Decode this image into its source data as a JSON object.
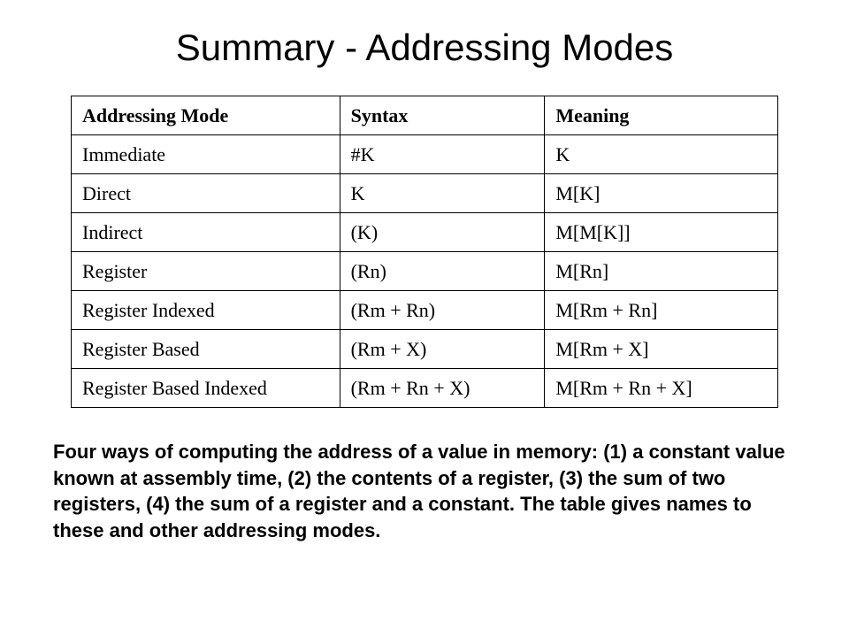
{
  "title": "Summary - Addressing Modes",
  "headers": {
    "col0": "Addressing Mode",
    "col1": "Syntax",
    "col2": "Meaning"
  },
  "rows": [
    {
      "mode": "Immediate",
      "syntax": "#K",
      "meaning": "K"
    },
    {
      "mode": "Direct",
      "syntax": "K",
      "meaning": "M[K]"
    },
    {
      "mode": "Indirect",
      "syntax": "(K)",
      "meaning": "M[M[K]]"
    },
    {
      "mode": "Register",
      "syntax": "(Rn)",
      "meaning": "M[Rn]"
    },
    {
      "mode": "Register Indexed",
      "syntax": "(Rm + Rn)",
      "meaning": "M[Rm + Rn]"
    },
    {
      "mode": "Register Based",
      "syntax": "(Rm + X)",
      "meaning": "M[Rm + X]"
    },
    {
      "mode": "Register Based Indexed",
      "syntax": "(Rm + Rn + X)",
      "meaning": "M[Rm + Rn + X]"
    }
  ],
  "caption": "Four ways of computing the address of a value in memory: (1) a constant value known at assembly time, (2) the contents of a regis­ter, (3) the sum of two registers, (4) the sum of a register and a con­stant. The table gives names to these and other addressing modes."
}
